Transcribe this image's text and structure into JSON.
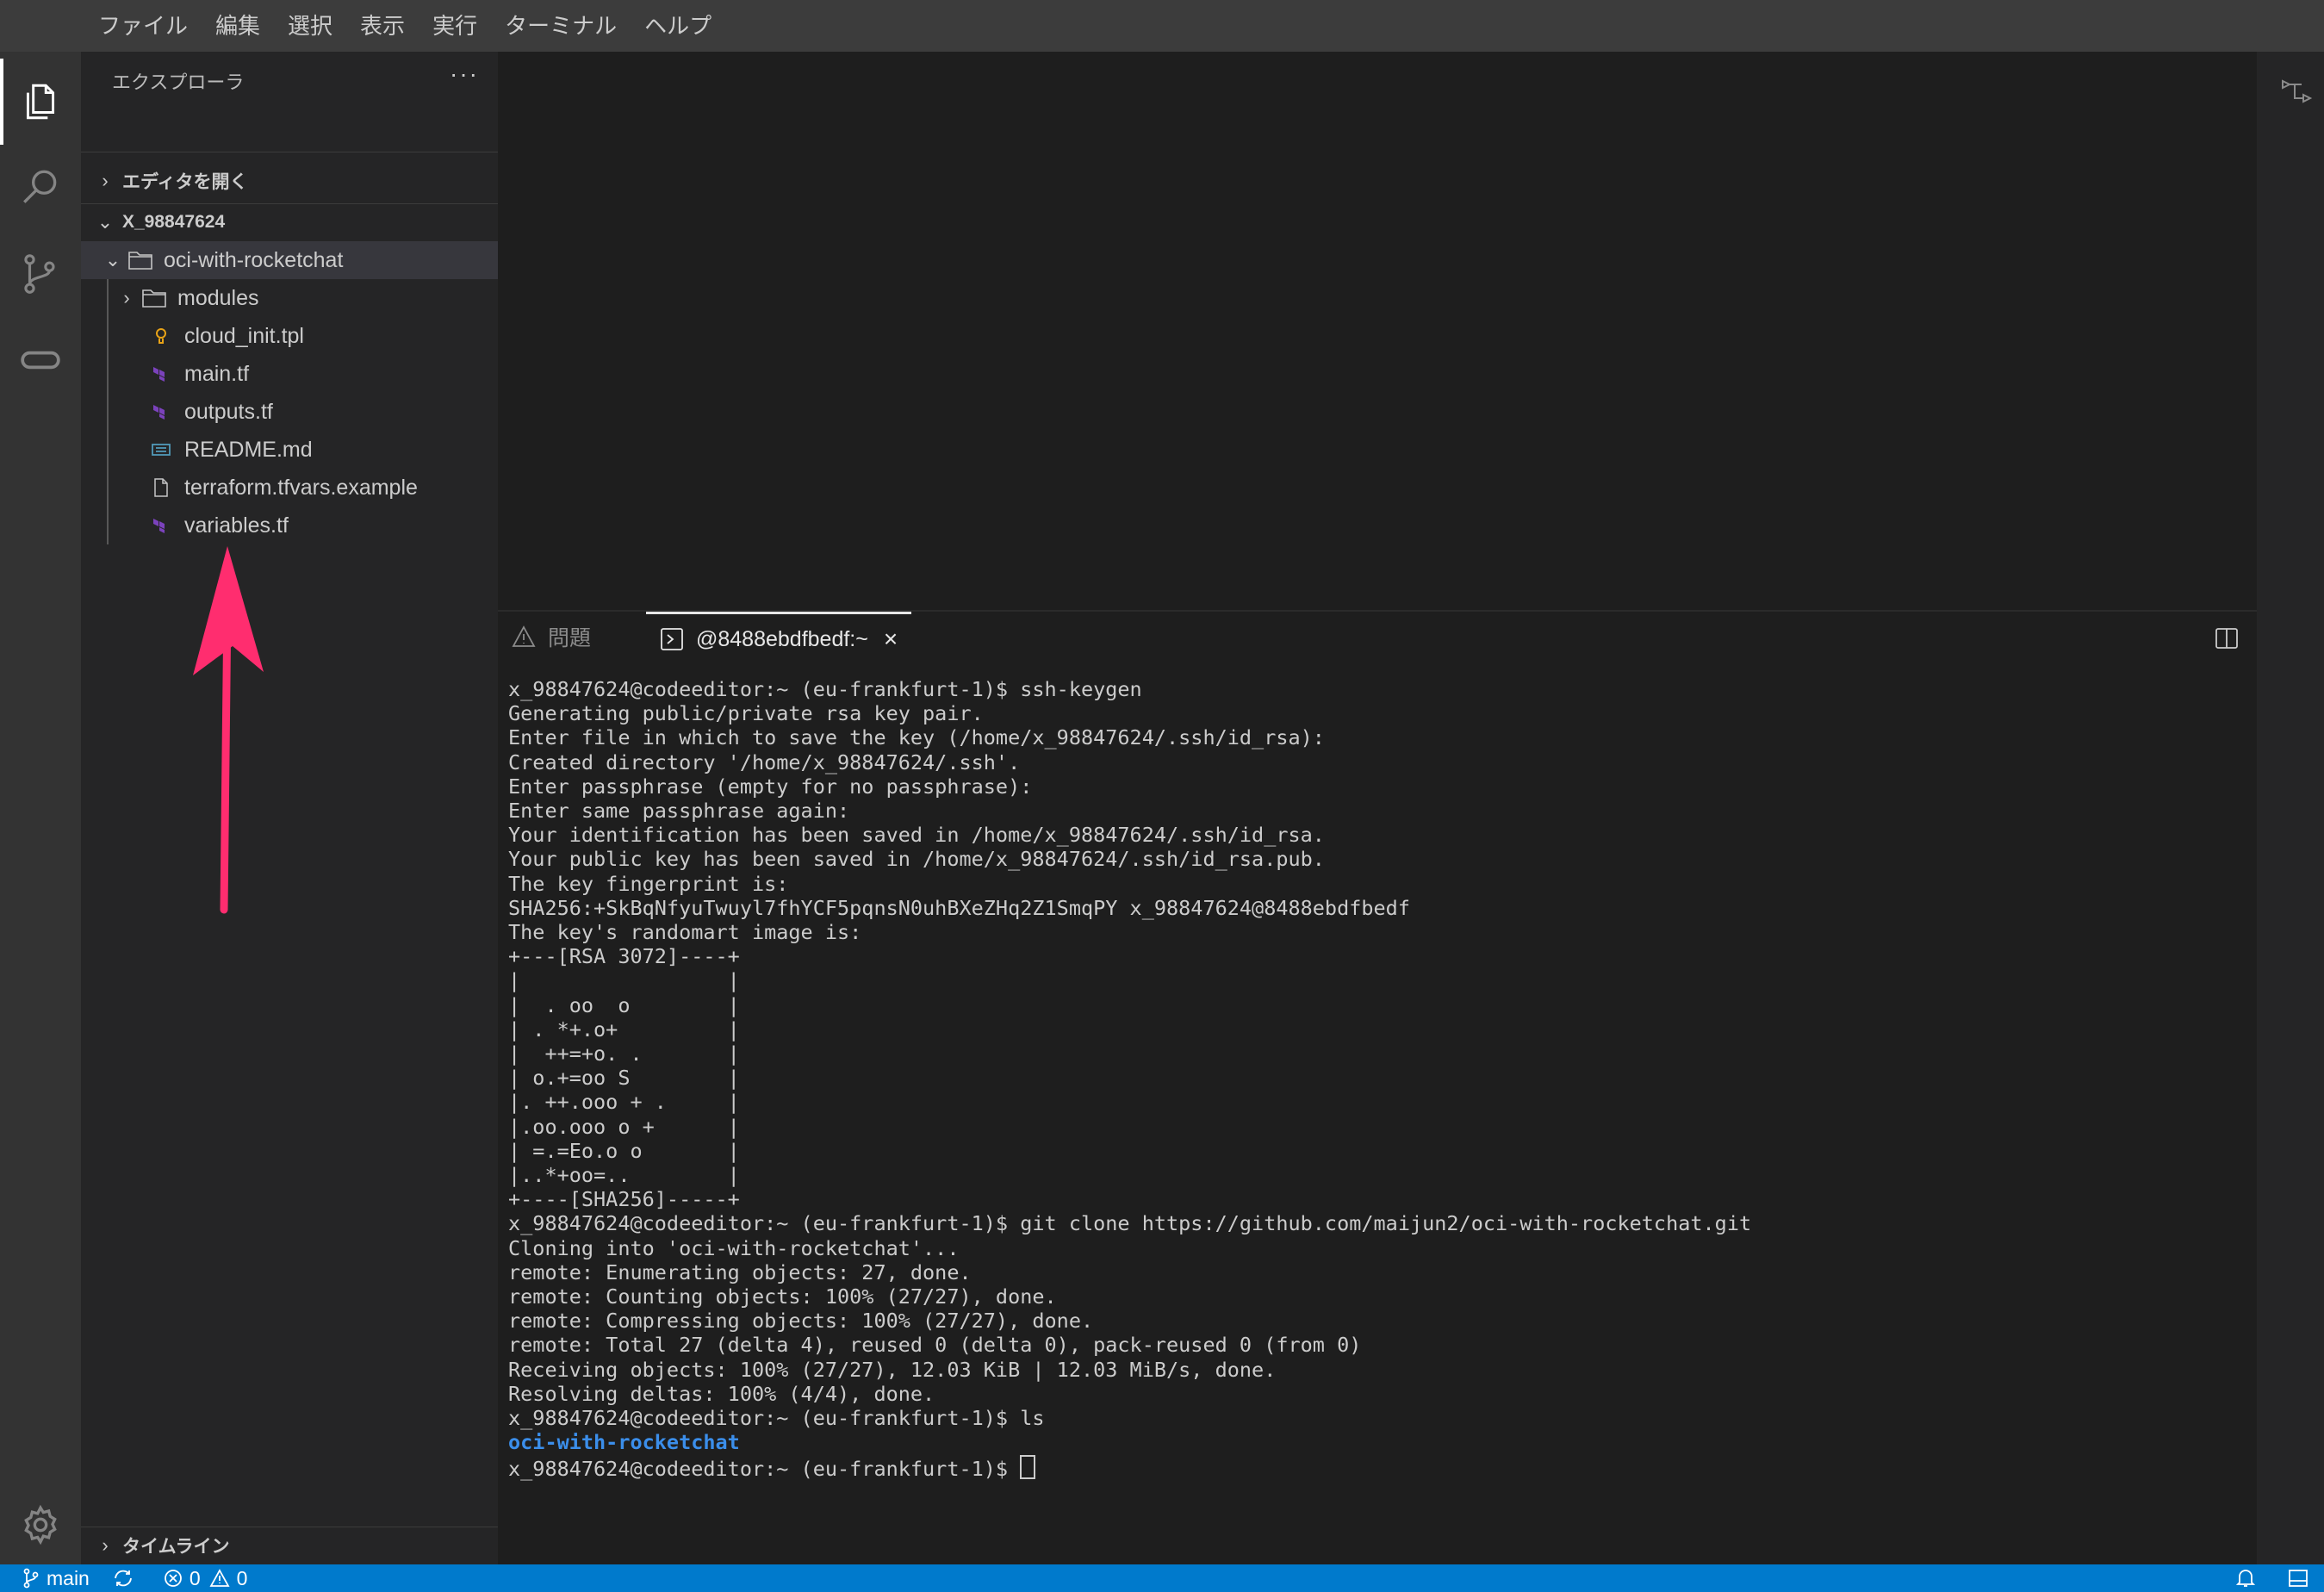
{
  "menubar": {
    "items": [
      "ファイル",
      "編集",
      "選択",
      "表示",
      "実行",
      "ターミナル",
      "ヘルプ"
    ]
  },
  "activitybar": {
    "icons": [
      "files-icon",
      "search-icon",
      "source-control-icon",
      "remote-icon",
      "settings-gear-icon"
    ]
  },
  "sidebar": {
    "title": "エクスプローラ",
    "more": "···",
    "open_editors": "エディタを開く",
    "workspace": "X_98847624",
    "tree": [
      {
        "name": "oci-with-rocketchat",
        "type": "folder",
        "expanded": true
      },
      {
        "name": "modules",
        "type": "folder",
        "expanded": false
      },
      {
        "name": "cloud_init.tpl",
        "type": "file",
        "icon": "tpl-icon"
      },
      {
        "name": "main.tf",
        "type": "file",
        "icon": "terraform-icon"
      },
      {
        "name": "outputs.tf",
        "type": "file",
        "icon": "terraform-icon"
      },
      {
        "name": "README.md",
        "type": "file",
        "icon": "markdown-icon"
      },
      {
        "name": "terraform.tfvars.example",
        "type": "file",
        "icon": "file-icon"
      },
      {
        "name": "variables.tf",
        "type": "file",
        "icon": "terraform-icon"
      }
    ],
    "timeline": "タイムライン"
  },
  "panel": {
    "tabs": [
      {
        "label": "問題",
        "active": false
      },
      {
        "label": "@8488ebdfbedf:~",
        "active": true
      }
    ]
  },
  "terminal": {
    "lines": [
      "x_98847624@codeeditor:~ (eu-frankfurt-1)$ ssh-keygen",
      "Generating public/private rsa key pair.",
      "Enter file in which to save the key (/home/x_98847624/.ssh/id_rsa):",
      "Created directory '/home/x_98847624/.ssh'.",
      "Enter passphrase (empty for no passphrase):",
      "Enter same passphrase again:",
      "Your identification has been saved in /home/x_98847624/.ssh/id_rsa.",
      "Your public key has been saved in /home/x_98847624/.ssh/id_rsa.pub.",
      "The key fingerprint is:",
      "SHA256:+SkBqNfyuTwuyl7fhYCF5pqnsN0uhBXeZHq2Z1SmqPY x_98847624@8488ebdfbedf",
      "The key's randomart image is:",
      "+---[RSA 3072]----+",
      "|                 |",
      "|  . oo  o        |",
      "| . *+.o+         |",
      "|  ++=+o. .       |",
      "| o.+=oo S        |",
      "|. ++.ooo + .     |",
      "|.oo.ooo o +      |",
      "| =.=Eo.o o       |",
      "|..*+oo=..        |",
      "+----[SHA256]-----+",
      "x_98847624@codeeditor:~ (eu-frankfurt-1)$ git clone https://github.com/maijun2/oci-with-rocketchat.git",
      "Cloning into 'oci-with-rocketchat'...",
      "remote: Enumerating objects: 27, done.",
      "remote: Counting objects: 100% (27/27), done.",
      "remote: Compressing objects: 100% (27/27), done.",
      "remote: Total 27 (delta 4), reused 0 (delta 0), pack-reused 0 (from 0)",
      "Receiving objects: 100% (27/27), 12.03 KiB | 12.03 MiB/s, done.",
      "Resolving deltas: 100% (4/4), done.",
      "x_98847624@codeeditor:~ (eu-frankfurt-1)$ ls"
    ],
    "ls_output": "oci-with-rocketchat",
    "prompt": "x_98847624@codeeditor:~ (eu-frankfurt-1)$ "
  },
  "statusbar": {
    "branch": "main",
    "errors": "0",
    "warnings": "0"
  },
  "colors": {
    "statusbar": "#007acc",
    "annotation_arrow": "#ff2d6f",
    "terminal_dir": "#3b8eea"
  }
}
